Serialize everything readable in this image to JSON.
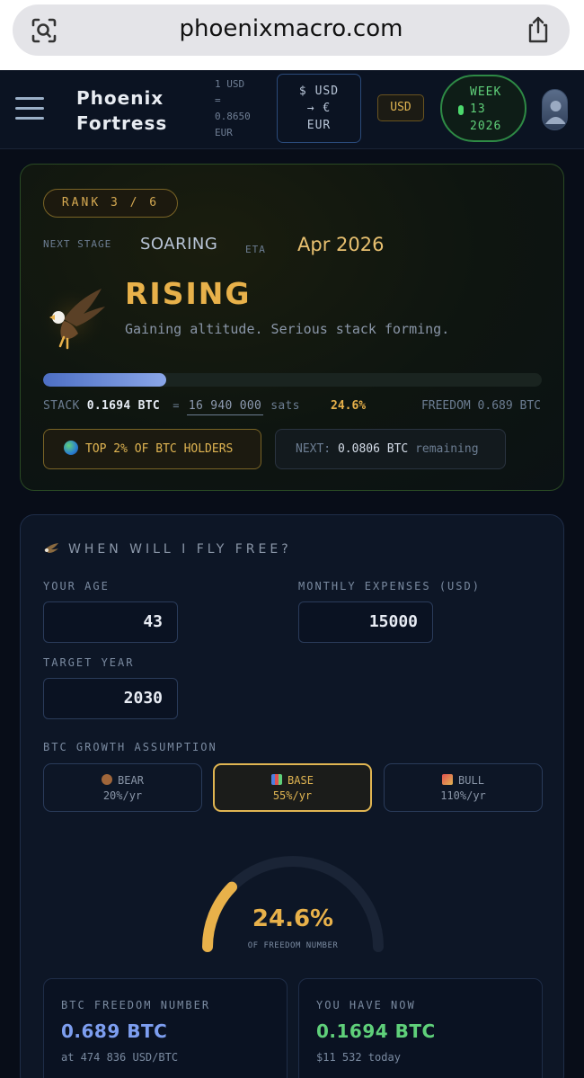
{
  "browser": {
    "url": "phoenixmacro.com"
  },
  "header": {
    "brand_line1": "Phoenix",
    "brand_line2": "Fortress",
    "rate_line1": "1 USD",
    "rate_line2": "=",
    "rate_line3": "0.8650",
    "rate_line4": "EUR",
    "convert_line1": "$ USD",
    "convert_line2": "→ €",
    "convert_line3": "EUR",
    "currency": "USD",
    "week_line1": "WEEK",
    "week_line2": "13",
    "week_line3": "2026"
  },
  "rank": {
    "rank_label": "RANK 3 / 6",
    "next_stage_label": "NEXT STAGE",
    "next_stage": "SOARING",
    "eta_label": "ETA",
    "eta": "Apr 2026",
    "stage": "RISING",
    "stage_desc": "Gaining altitude. Serious stack forming.",
    "progress_fraction": 0.246,
    "stack_label": "STACK",
    "stack_value": "0.1694 BTC",
    "eq": "=",
    "sats": "16 940 000",
    "sats_unit": "sats",
    "percent": "24.6%",
    "freedom_label": "FREEDOM 0.689 BTC",
    "top_badge": "TOP 2% OF BTC HOLDERS",
    "next_label": "NEXT:",
    "next_value": "0.0806 BTC",
    "next_suffix": "remaining"
  },
  "freedom": {
    "title": "WHEN WILL I FLY FREE?",
    "age_label": "YOUR AGE",
    "age": "43",
    "expenses_label": "MONTHLY EXPENSES (USD)",
    "expenses": "15000",
    "target_label": "TARGET YEAR",
    "target": "2030",
    "growth_label": "BTC GROWTH ASSUMPTION",
    "scenarios": [
      {
        "name": "BEAR",
        "rate": "20%/yr"
      },
      {
        "name": "BASE",
        "rate": "55%/yr"
      },
      {
        "name": "BULL",
        "rate": "110%/yr"
      }
    ],
    "selected_scenario": "BASE",
    "gauge_fraction": 0.246,
    "gauge_percent": "24.6%",
    "gauge_label": "OF FREEDOM NUMBER",
    "freedom_number_label": "BTC FREEDOM NUMBER",
    "freedom_number": "0.689 BTC",
    "freedom_number_sub": "at 474 836 USD/BTC",
    "have_label": "YOU HAVE NOW",
    "have_value": "0.1694 BTC",
    "have_sub": "$11 532 today"
  },
  "colors": {
    "gold": "#e8b14a",
    "blue": "#7d9ef0",
    "green": "#5fd07a",
    "bg": "#080d18"
  },
  "icons": [
    "camera-search-icon",
    "share-icon",
    "menu-icon",
    "user-icon",
    "eagle-icon",
    "globe-icon",
    "bear-icon",
    "chart-icon",
    "rocket-icon"
  ]
}
